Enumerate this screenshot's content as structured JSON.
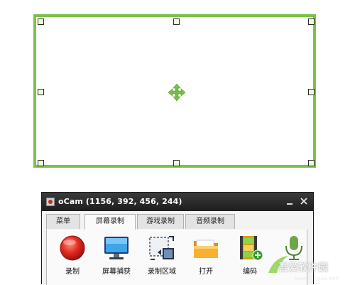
{
  "window": {
    "title": "oCam (1156, 392, 456, 244)",
    "controls": [
      "minimize",
      "close"
    ],
    "close_glyph": "✕"
  },
  "tabs": [
    {
      "label": "菜单",
      "active": false
    },
    {
      "label": "屏幕录制",
      "active": true
    },
    {
      "label": "游戏录制",
      "active": false
    },
    {
      "label": "音频录制",
      "active": false
    }
  ],
  "toolbar": [
    {
      "label": "录制",
      "icon": "record-icon"
    },
    {
      "label": "屏幕捕获",
      "icon": "monitor-icon"
    },
    {
      "label": "录制区域",
      "icon": "record-area-icon"
    },
    {
      "label": "打开",
      "icon": "folder-icon"
    },
    {
      "label": "编码",
      "icon": "codec-icon"
    },
    {
      "label": "",
      "icon": "microphone-icon"
    }
  ],
  "capture_region": {
    "icon": "move-icon",
    "color": "#7dc14a"
  },
  "watermark": {
    "text": "吾爱软件园",
    "url": "www.52zixue.com"
  },
  "colors": {
    "accent": "#7dc14a",
    "titlebar": "#2a2a2a",
    "record_red": "#d42a1f"
  }
}
